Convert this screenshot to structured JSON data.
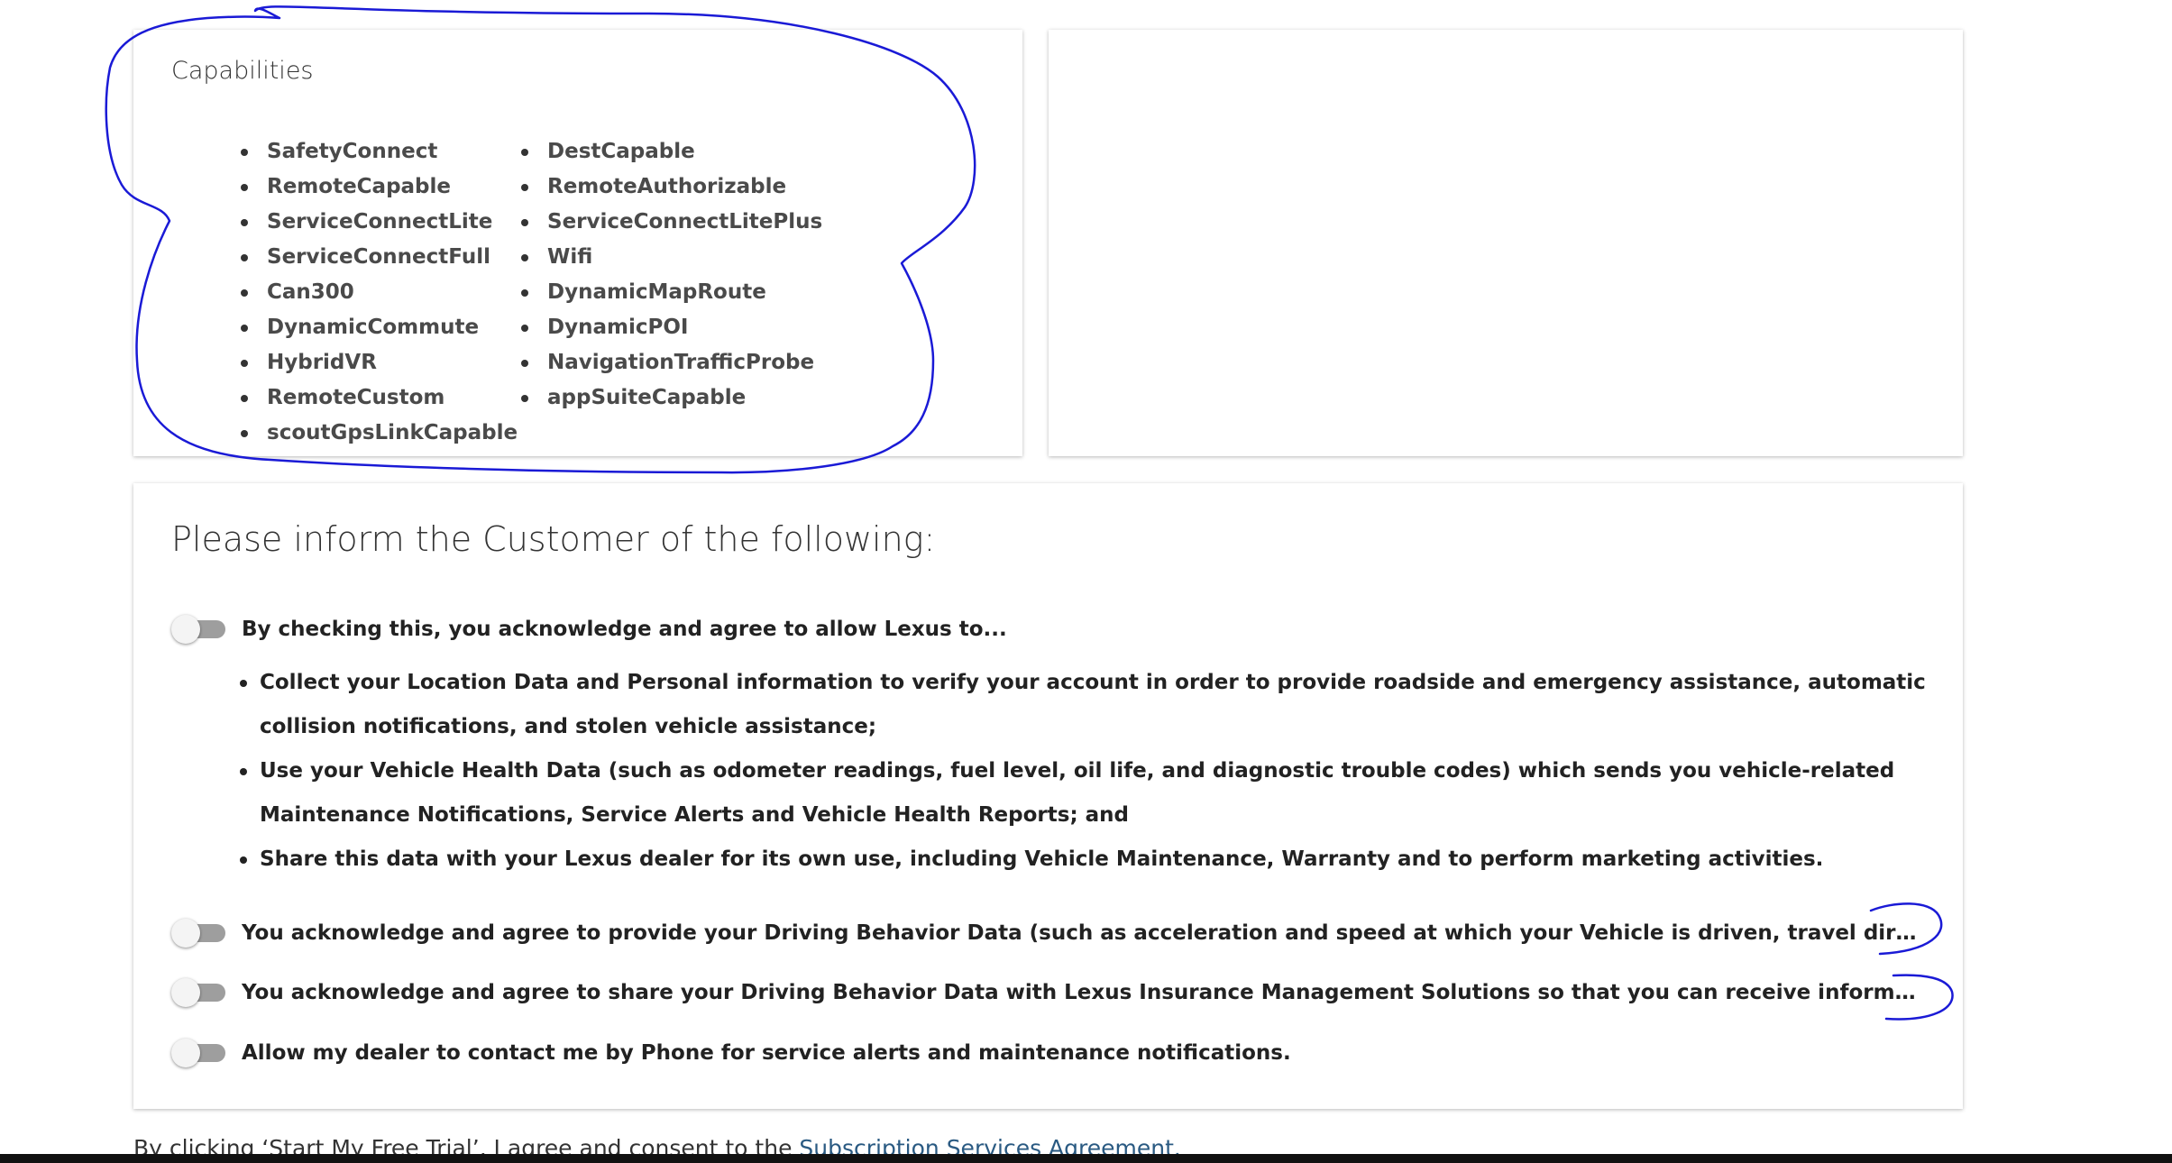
{
  "capabilities": {
    "title": "Capabilities",
    "column_1": [
      "SafetyConnect",
      "RemoteCapable",
      "ServiceConnectLite",
      "ServiceConnectFull",
      "Can300",
      "DynamicCommute",
      "HybridVR",
      "RemoteCustom",
      "scoutGpsLinkCapable"
    ],
    "column_2": [
      "DestCapable",
      "RemoteAuthorizable",
      "ServiceConnectLitePlus",
      "Wifi",
      "DynamicMapRoute",
      "DynamicPOI",
      "NavigationTrafficProbe",
      "appSuiteCapable"
    ]
  },
  "inform": {
    "title": "Please inform the Customer of the following:",
    "toggles": [
      {
        "label": "By checking this, you acknowledge and agree to allow Lexus to...",
        "checked": false
      },
      {
        "label": "You acknowledge and agree to provide your Driving Behavior Data (such as acceleration and speed at which your Vehicle is driven, travel direction, and use of the steering an...",
        "checked": false
      },
      {
        "label": "You acknowledge and agree to share your Driving Behavior Data with Lexus Insurance Management Solutions so that you can receive information about eligible insurance pro...",
        "checked": false
      },
      {
        "label": "Allow my dealer to contact me by Phone for service alerts and maintenance notifications.",
        "checked": false
      }
    ],
    "consent_items": [
      "Collect your Location Data and Personal information to verify your account in order to provide roadside and emergency assistance, automatic collision notifications, and stolen vehicle assistance;",
      "Use your Vehicle Health Data (such as odometer readings, fuel level, oil life, and diagnostic trouble codes) which sends you vehicle-related Maintenance Notifications, Service Alerts and Vehicle Health Reports; and",
      "Share this data with your Lexus dealer for its own use, including Vehicle Maintenance, Warranty and to perform marketing activities."
    ]
  },
  "footer": {
    "text": "By clicking ‘Start My Free Trial’, I agree and consent to the ",
    "link": "Subscription Services Agreement."
  },
  "colors": {
    "annotation_ink": "#1a1ad6",
    "link": "#2a5a82",
    "toggle_off_track": "#9e9e9e"
  }
}
